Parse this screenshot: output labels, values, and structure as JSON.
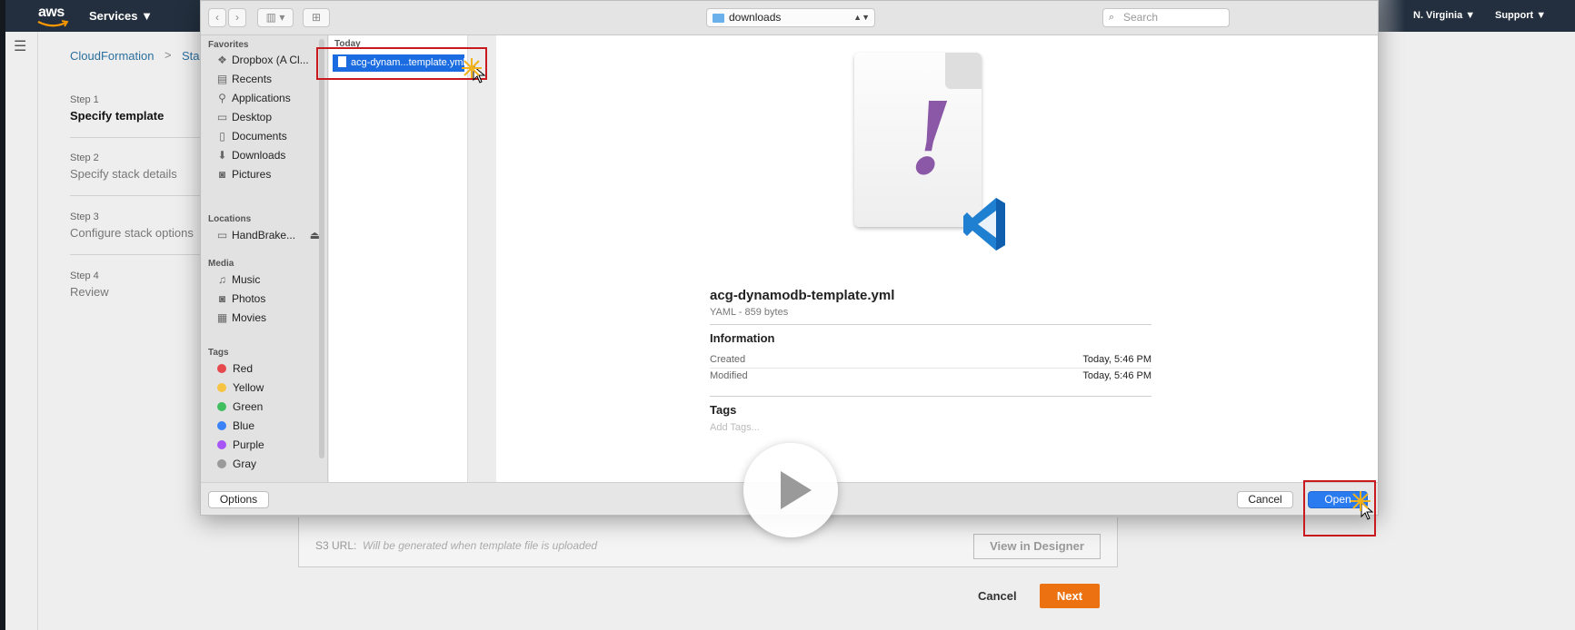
{
  "aws": {
    "logo_text": "aws",
    "services": "Services ▼",
    "region": "N. Virginia ▼",
    "support": "Support ▼"
  },
  "breadcrumb": {
    "root": "CloudFormation",
    "separator": ">",
    "current": "Sta"
  },
  "steps": [
    {
      "num": "Step 1",
      "name": "Specify template"
    },
    {
      "num": "Step 2",
      "name": "Specify stack details"
    },
    {
      "num": "Step 3",
      "name": "Configure stack options"
    },
    {
      "num": "Step 4",
      "name": "Review"
    }
  ],
  "s3": {
    "label": "S3 URL:",
    "value": "Will be generated when template file is uploaded",
    "designer_button": "View in Designer"
  },
  "page_buttons": {
    "cancel": "Cancel",
    "next": "Next"
  },
  "dialog": {
    "location": "downloads",
    "search_placeholder": "Search",
    "sidebar": {
      "favorites_header": "Favorites",
      "favorites": [
        {
          "label": "Dropbox (A Cl...",
          "icon": "dropbox-icon",
          "glyph": "❖"
        },
        {
          "label": "Recents",
          "icon": "recents-icon",
          "glyph": "▤"
        },
        {
          "label": "Applications",
          "icon": "applications-icon",
          "glyph": "⚲"
        },
        {
          "label": "Desktop",
          "icon": "desktop-icon",
          "glyph": "▭"
        },
        {
          "label": "Documents",
          "icon": "documents-icon",
          "glyph": "▯"
        },
        {
          "label": "Downloads",
          "icon": "downloads-icon",
          "glyph": "⬇"
        },
        {
          "label": "Pictures",
          "icon": "pictures-icon",
          "glyph": "◙"
        }
      ],
      "locations_header": "Locations",
      "locations": [
        {
          "label": "HandBrake...",
          "icon": "drive-icon",
          "glyph": "▭",
          "eject": "⏏"
        }
      ],
      "media_header": "Media",
      "media": [
        {
          "label": "Music",
          "icon": "music-icon",
          "glyph": "♫"
        },
        {
          "label": "Photos",
          "icon": "photos-icon",
          "glyph": "◙"
        },
        {
          "label": "Movies",
          "icon": "movies-icon",
          "glyph": "▦"
        }
      ],
      "tags_header": "Tags",
      "tags": [
        {
          "label": "Red",
          "color": "#e5484d"
        },
        {
          "label": "Yellow",
          "color": "#f6c343"
        },
        {
          "label": "Green",
          "color": "#3fbf5f"
        },
        {
          "label": "Blue",
          "color": "#3b82f6"
        },
        {
          "label": "Purple",
          "color": "#a855f7"
        },
        {
          "label": "Gray",
          "color": "#9a9a9a"
        }
      ]
    },
    "column_header": "Today",
    "selected_file": "acg-dynam...template.yml",
    "preview": {
      "filename": "acg-dynamodb-template.yml",
      "kind": "YAML - 859 bytes",
      "information_header": "Information",
      "created_label": "Created",
      "created_value": "Today, 5:46 PM",
      "modified_label": "Modified",
      "modified_value": "Today, 5:46 PM",
      "tags_header": "Tags",
      "tags_placeholder": "Add Tags..."
    },
    "buttons": {
      "options": "Options",
      "cancel": "Cancel",
      "open": "Open"
    }
  },
  "colors": {
    "aws_nav": "#232f3e",
    "aws_orange": "#ec7211",
    "link_blue": "#2b6f9e",
    "finder_selection": "#1a6ce0",
    "highlight_red": "#c8191e"
  }
}
